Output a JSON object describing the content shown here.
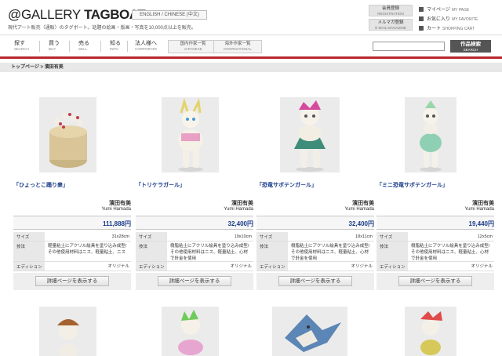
{
  "header": {
    "logo_prefix": "@GALLERY ",
    "logo_bold": "TAGBOAT",
    "tagline": "現代アート販売（通販）のタグボート。話題の絵画・版画・写真を10,000点以上を販売。",
    "lang_switch": "ENGLISH / CHINESE (中文)",
    "registration": {
      "label": "会員登録",
      "sub": "REGISTRATION"
    },
    "magazine": {
      "label": "メルマガ登録",
      "sub": "E-MAIL MAGAZINE"
    },
    "links": [
      {
        "label": "マイページ",
        "sub": "MY PAGE"
      },
      {
        "label": "お気に入り",
        "sub": "MY FAVORITE"
      },
      {
        "label": "カート",
        "sub": "SHOPPING CART"
      }
    ]
  },
  "nav": {
    "items": [
      {
        "label": "探す",
        "sub": "SEARCH"
      },
      {
        "label": "買う",
        "sub": "BUY"
      },
      {
        "label": "売る",
        "sub": "SELL"
      },
      {
        "label": "知る",
        "sub": "INFO"
      },
      {
        "label": "法人様へ",
        "sub": "CORPORATE"
      }
    ],
    "japanese": {
      "label": "国内作家一覧",
      "sub": "JAPANESE"
    },
    "international": {
      "label": "海外作家一覧",
      "sub": "INTERNATIONAL"
    },
    "search_placeholder": "",
    "search_button": {
      "label": "作品検索",
      "sub": "SEARCH"
    }
  },
  "breadcrumb": "トップページ > 濱田有美",
  "spec_labels": {
    "size": "サイズ",
    "technique": "技法",
    "edition": "エディション"
  },
  "detail_button": "詳細ページを表示する",
  "products": [
    {
      "title": "「ひょっとこ踊り衆」",
      "artist": "濱田有美",
      "artist_en": "Yumi Hamada",
      "price": "111,888円",
      "size": "31x28cm",
      "technique": "軽量粘土にアクリル絵具を塗り込み成型/その他使用材料はニス、軽量粘土、ニス",
      "edition": "オリジナル"
    },
    {
      "title": "「トリケラガール」",
      "artist": "濱田有美",
      "artist_en": "Yumi Hamada",
      "price": "32,400円",
      "size": "19x10cm",
      "technique": "樹脂粘土にアクリル絵具を塗り込み成型/その他使用材料はニス、軽量粘土、心材で針金を使用",
      "edition": "オリジナル"
    },
    {
      "title": "「恐竜サボテンガール」",
      "artist": "濱田有美",
      "artist_en": "Yumi Hamada",
      "price": "32,400円",
      "size": "18x11cm",
      "technique": "樹脂粘土にアクリル絵具を塗り込み成型/その他使用材料はニス、軽量粘土、心材で針金を使用",
      "edition": "オリジナル"
    },
    {
      "title": "「ミニ恐竜サボテンガール」",
      "artist": "濱田有美",
      "artist_en": "Yumi Hamada",
      "price": "19,440円",
      "size": "12x5cm",
      "technique": "樹脂粘土にアクリル絵具を塗り込み成型/その他使用材料はニス、軽量粘土、心材で針金を使用",
      "edition": "オリジナル"
    }
  ]
}
